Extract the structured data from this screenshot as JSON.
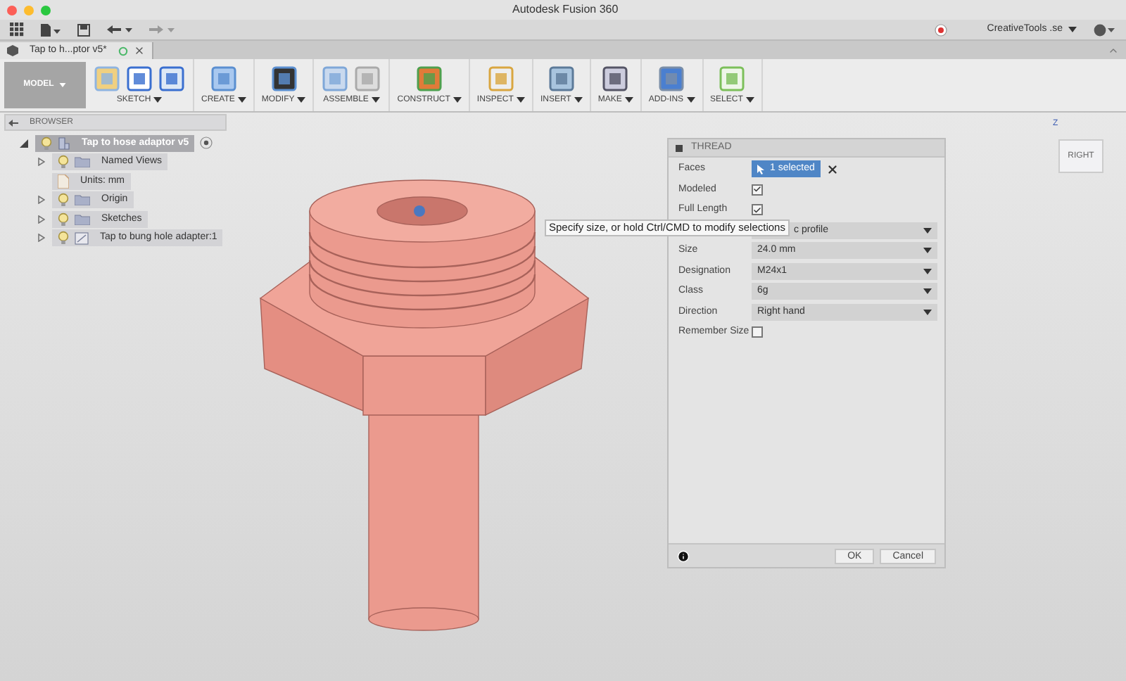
{
  "window": {
    "title": "Autodesk Fusion 360"
  },
  "quick_access": {
    "account": "CreativeTools .se"
  },
  "document_tab": {
    "label": "Tap to h...ptor v5*",
    "selected": true
  },
  "toolbar": {
    "mode": "MODEL",
    "groups": [
      {
        "label": "SKETCH"
      },
      {
        "label": "CREATE"
      },
      {
        "label": "MODIFY"
      },
      {
        "label": "ASSEMBLE"
      },
      {
        "label": "CONSTRUCT"
      },
      {
        "label": "INSPECT"
      },
      {
        "label": "INSERT"
      },
      {
        "label": "MAKE"
      },
      {
        "label": "ADD-INS"
      },
      {
        "label": "SELECT"
      }
    ]
  },
  "browser": {
    "title": "BROWSER",
    "tree": [
      {
        "label": "Tap to hose adaptor v5",
        "kind": "component",
        "expanded": true,
        "selected": true,
        "children": [
          {
            "label": "Named Views",
            "kind": "folder",
            "expanded": false,
            "selected": false
          },
          {
            "label": "Units: mm",
            "kind": "units",
            "selected": false
          },
          {
            "label": "Origin",
            "kind": "folder",
            "expanded": false,
            "selected": false
          },
          {
            "label": "Sketches",
            "kind": "folder",
            "expanded": false,
            "selected": false
          },
          {
            "label": "Tap to bung hole adapter:1",
            "kind": "occurrence",
            "expanded": false,
            "selected": false
          }
        ]
      }
    ]
  },
  "view_cube": {
    "face": "RIGHT",
    "axis": "Z"
  },
  "tooltip": "Specify size, or hold Ctrl/CMD to modify selections",
  "thread_dialog": {
    "title": "THREAD",
    "rows": [
      {
        "kind": "selection",
        "label": "Faces",
        "value": "1 selected"
      },
      {
        "kind": "checkbox",
        "label": "Modeled",
        "checked": true
      },
      {
        "kind": "checkbox",
        "label": "Full Length",
        "checked": true
      },
      {
        "kind": "dropdown",
        "value": "c profile"
      },
      {
        "kind": "dropdown",
        "label": "Size",
        "value": "24.0 mm"
      },
      {
        "kind": "dropdown",
        "label": "Designation",
        "value": "M24x1"
      },
      {
        "kind": "dropdown",
        "label": "Class",
        "value": "6g"
      },
      {
        "kind": "dropdown",
        "label": "Direction",
        "value": "Right hand"
      },
      {
        "kind": "checkbox",
        "label": "Remember Size",
        "checked": false
      }
    ],
    "buttons": [
      "OK",
      "Cancel"
    ]
  }
}
